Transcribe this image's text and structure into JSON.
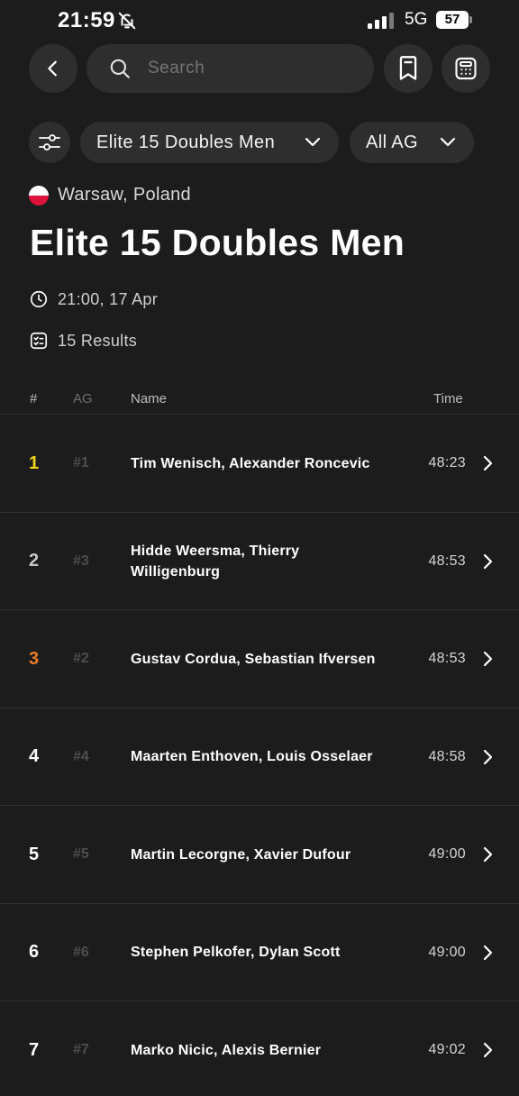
{
  "status_bar": {
    "time": "21:59",
    "network": "5G",
    "battery": "57"
  },
  "nav": {
    "search_placeholder": "Search"
  },
  "filters": {
    "event": "Elite 15 Doubles Men",
    "age_group": "All AG"
  },
  "event": {
    "location": "Warsaw, Poland",
    "title": "Elite 15 Doubles Men",
    "datetime": "21:00, 17 Apr",
    "results_count": "15 Results"
  },
  "table": {
    "headers": {
      "rank": "#",
      "ag": "AG",
      "name": "Name",
      "time": "Time"
    },
    "rows": [
      {
        "rank": "1",
        "ag": "#1",
        "name": "Tim Wenisch, Alexander Roncevic",
        "time": "48:23",
        "rank_color": "#f2d21a"
      },
      {
        "rank": "2",
        "ag": "#3",
        "name": "Hidde Weersma, Thierry Willigenburg",
        "time": "48:53",
        "rank_color": "#c8c8c8"
      },
      {
        "rank": "3",
        "ag": "#2",
        "name": "Gustav Cordua, Sebastian Ifversen",
        "time": "48:53",
        "rank_color": "#e87b23"
      },
      {
        "rank": "4",
        "ag": "#4",
        "name": "Maarten Enthoven, Louis Osselaer",
        "time": "48:58",
        "rank_color": "#ffffff"
      },
      {
        "rank": "5",
        "ag": "#5",
        "name": "Martin Lecorgne, Xavier Dufour",
        "time": "49:00",
        "rank_color": "#ffffff"
      },
      {
        "rank": "6",
        "ag": "#6",
        "name": "Stephen Pelkofer, Dylan Scott",
        "time": "49:00",
        "rank_color": "#ffffff"
      },
      {
        "rank": "7",
        "ag": "#7",
        "name": "Marko Nicic, Alexis Bernier",
        "time": "49:02",
        "rank_color": "#ffffff"
      }
    ]
  },
  "icons": {
    "status": [
      "bell-off-icon",
      "signal-icon",
      "battery-icon"
    ],
    "nav": [
      "back-icon",
      "search-icon",
      "bookmark-icon",
      "calculator-icon"
    ],
    "filters": [
      "sliders-icon",
      "chevron-down-icon"
    ],
    "meta": [
      "poland-flag-icon",
      "clock-icon",
      "results-list-icon"
    ],
    "row": "chevron-right-icon"
  }
}
